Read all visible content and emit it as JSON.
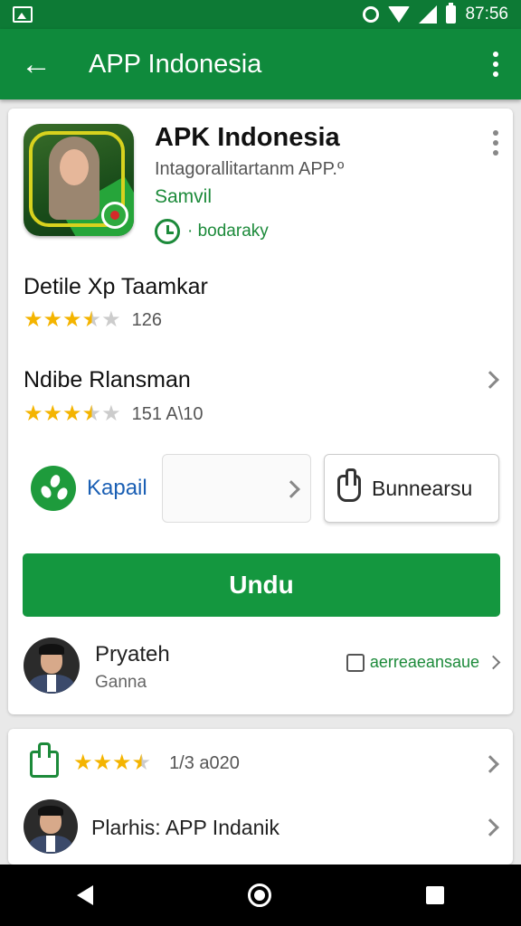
{
  "status_bar": {
    "time": "87:56"
  },
  "app_bar": {
    "title": "APP Indonesia"
  },
  "app": {
    "name": "APK Indonesia",
    "subtitle": "Intagorallitartanm APP.º",
    "developer": "Samvil",
    "meta": "· bodaraky"
  },
  "sections": [
    {
      "title": "Detile Xp Taamkar",
      "rating": 3.5,
      "count": "126"
    },
    {
      "title": "Ndibe Rlansman",
      "rating": 3.5,
      "count": "151 A\\10"
    }
  ],
  "actions": {
    "kapail_label": "Kapail",
    "secondary_label": "Bunnearsu"
  },
  "download_label": "Undu",
  "review": {
    "name": "Pryateh",
    "sub": "Ganna",
    "action": "aerreaeansaue"
  },
  "card2": {
    "rating": 3.5,
    "rating_text": "1/3 a020",
    "publisher": "Plarhis:  APP Indanik"
  },
  "colors": {
    "primary": "#0f8a3c",
    "status": "#0d7a35",
    "star": "#f4b400",
    "link": "#1a5fb4"
  }
}
